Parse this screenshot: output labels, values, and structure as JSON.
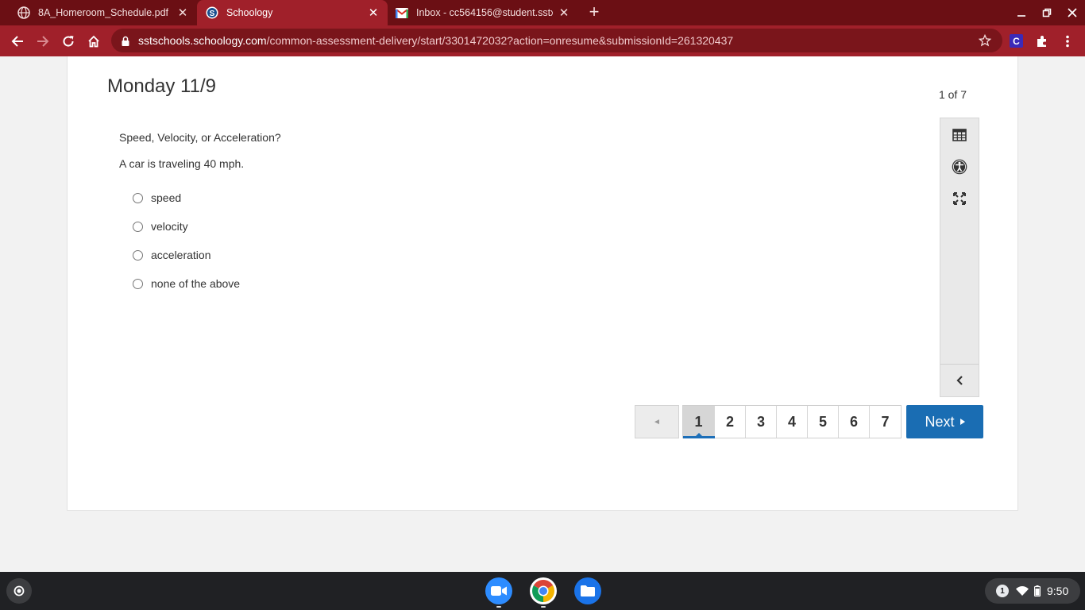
{
  "browser": {
    "tabs": [
      {
        "title": "8A_Homeroom_Schedule.pdf",
        "icon": "globe-icon",
        "active": false
      },
      {
        "title": "Schoology",
        "icon": "schoology-icon",
        "active": true
      },
      {
        "title": "Inbox - cc564156@student.sstx",
        "icon": "gmail-icon",
        "active": false
      }
    ],
    "url_host": "sstschools.schoology.com",
    "url_path": "/common-assessment-delivery/start/3301472032?action=onresume&submissionId=261320437",
    "extension_label": "C",
    "theme_color": "#a0202a"
  },
  "assessment": {
    "title": "Monday 11/9",
    "counter": "1 of 7",
    "question": "Speed, Velocity, or Acceleration?",
    "prompt": "A car is traveling 40 mph.",
    "options": [
      "speed",
      "velocity",
      "acceleration",
      "none of the above"
    ],
    "pages": [
      "1",
      "2",
      "3",
      "4",
      "5",
      "6",
      "7"
    ],
    "current_page": "1",
    "next_label": "Next",
    "accent_color": "#1a6db3"
  },
  "tools": [
    "calculator-icon",
    "accessibility-icon",
    "fullscreen-icon",
    "collapse-panel-icon"
  ],
  "shelf": {
    "apps": [
      "zoom-icon",
      "chrome-icon",
      "files-icon"
    ],
    "notification_count": "1",
    "time": "9:50"
  }
}
